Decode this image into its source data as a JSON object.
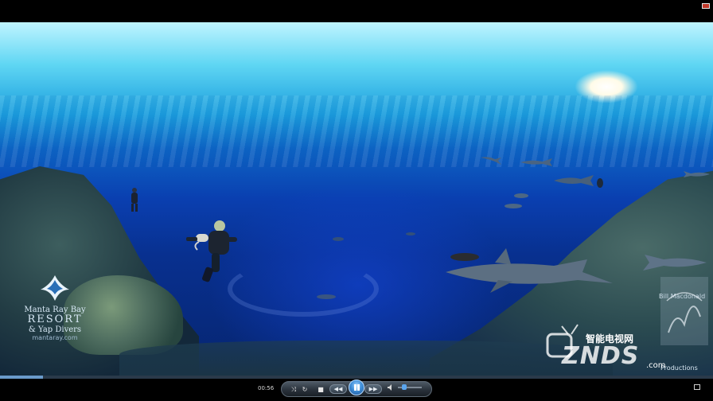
{
  "player": {
    "time": "00:56",
    "progress_fraction": 0.06,
    "volume_fraction": 0.25
  },
  "overlay": {
    "logo_line1": "Manta Ray Bay",
    "logo_line2": "RESORT",
    "logo_line3": "& Yap Divers",
    "logo_line4": "mantaray.com",
    "credit_top": "Bill Macdonald",
    "credit_bottom": "Productions",
    "watermark_cn": "智能电视网",
    "watermark_brand": "ZNDS",
    "watermark_domain": ".com"
  },
  "colors": {
    "close": "#c0392b",
    "accent": "#3f8fd9"
  },
  "icons": {
    "close": "close-icon",
    "shuffle": "shuffle-icon",
    "repeat": "repeat-icon",
    "stop": "stop-icon",
    "previous": "rewind-icon",
    "play_pause": "pause-icon",
    "next": "fast-forward-icon",
    "volume": "speaker-icon",
    "switch": "switch-to-library-icon"
  }
}
